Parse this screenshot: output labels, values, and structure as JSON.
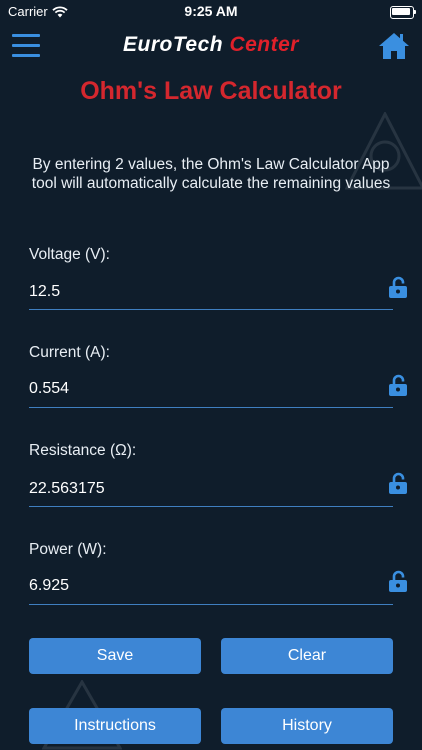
{
  "status_bar": {
    "carrier": "Carrier",
    "time": "9:25 AM"
  },
  "header": {
    "brand_part1": "EuroTech",
    "brand_part2": "Center"
  },
  "page": {
    "title": "Ohm's Law Calculator",
    "intro": "By entering 2 values, the Ohm's Law Calculator App tool will automatically calculate the remaining values"
  },
  "fields": [
    {
      "label": "Voltage (V):",
      "value": "12.5"
    },
    {
      "label": "Current (A):",
      "value": "0.554"
    },
    {
      "label": "Resistance (Ω):",
      "value": "22.563175"
    },
    {
      "label": "Power (W):",
      "value": "6.925"
    }
  ],
  "buttons": {
    "save": "Save",
    "clear": "Clear",
    "instructions": "Instructions",
    "history": "History"
  },
  "colors": {
    "background": "#0f1d2b",
    "title_red": "#d4272e",
    "accent_blue": "#3d86d5",
    "icon_blue": "#3a8fe0"
  }
}
